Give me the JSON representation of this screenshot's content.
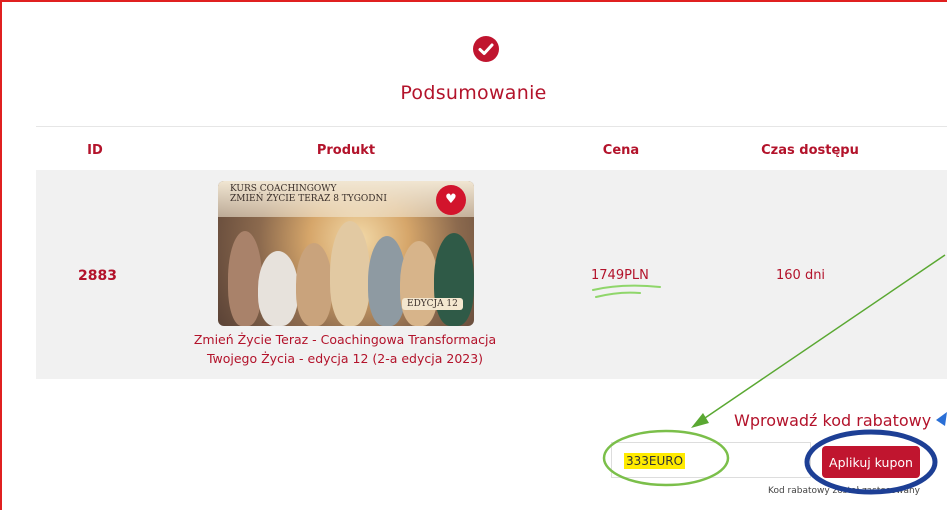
{
  "summary": {
    "title": "Podsumowanie"
  },
  "table": {
    "headers": [
      "ID",
      "Produkt",
      "Cena",
      "Czas dostępu"
    ],
    "row": {
      "id": "2883",
      "product_image_text": {
        "line1": "KURS COACHINGOWY",
        "line2": "ZMIEŃ ŻYCIE TERAZ 8 TYGODNI",
        "badge": "EDYCJA 12"
      },
      "product_name_line1": "Zmień Życie Teraz - Coachingowa Transformacja",
      "product_name_line2": "Twojego Życia - edycja 12 (2-a edycja 2023)",
      "price": "1749PLN",
      "access": "160 dni"
    }
  },
  "coupon": {
    "title": "Wprowadź kod rabatowy",
    "value": "333EURO",
    "apply_label": "Aplikuj kupon",
    "hint": "Kod rabatowy został zastosowany"
  },
  "colors": {
    "accent": "#b3132b",
    "button": "#c0152f",
    "annotation_green": "#5aa832",
    "annotation_blue": "#1d3f95",
    "highlight": "#ffeb00"
  },
  "icons": {
    "status": "check-circle-icon"
  }
}
